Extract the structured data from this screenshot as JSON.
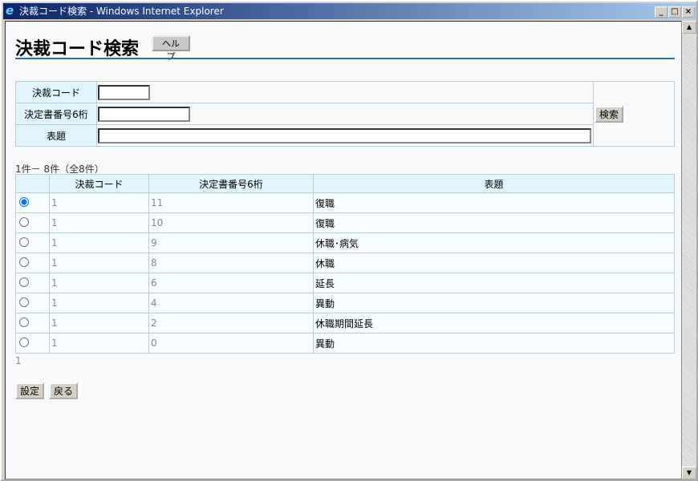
{
  "window": {
    "title": "決裁コード検索 - Windows Internet Explorer"
  },
  "page": {
    "title": "決裁コード検索",
    "help_label": "ヘルプ"
  },
  "search": {
    "code_label": "決裁コード",
    "number_label": "決定書番号6桁",
    "subject_label": "表題",
    "code_value": "",
    "number_value": "",
    "subject_value": "",
    "search_label": "検索"
  },
  "results": {
    "count_text": "1件－ 8件（全8件）",
    "headers": [
      "",
      "決裁コード",
      "決定書番号6桁",
      "表題"
    ],
    "rows": [
      {
        "code": "1",
        "number": "11",
        "subject": "復職",
        "selected": true
      },
      {
        "code": "1",
        "number": "10",
        "subject": "復職",
        "selected": false
      },
      {
        "code": "1",
        "number": "9",
        "subject": "休職･病気",
        "selected": false
      },
      {
        "code": "1",
        "number": "8",
        "subject": "休職",
        "selected": false
      },
      {
        "code": "1",
        "number": "6",
        "subject": "延長",
        "selected": false
      },
      {
        "code": "1",
        "number": "4",
        "subject": "異動",
        "selected": false
      },
      {
        "code": "1",
        "number": "2",
        "subject": "休職期間延長",
        "selected": false
      },
      {
        "code": "1",
        "number": "0",
        "subject": "異動",
        "selected": false
      }
    ],
    "pagination": "1"
  },
  "actions": {
    "set_label": "設定",
    "back_label": "戻る"
  }
}
